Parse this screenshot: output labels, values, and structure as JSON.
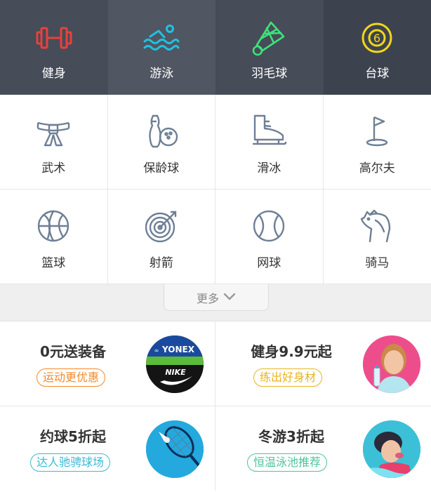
{
  "top_row": [
    {
      "label": "健身",
      "icon": "dumbbell-icon",
      "bg": "#464c58",
      "color": "#e8413c"
    },
    {
      "label": "游泳",
      "icon": "swimmer-icon",
      "bg": "#505662",
      "color": "#1ec3e0"
    },
    {
      "label": "羽毛球",
      "icon": "shuttlecock-icon",
      "bg": "#464c58",
      "color": "#3ee27a"
    },
    {
      "label": "台球",
      "icon": "billiard-ball-icon",
      "bg": "#3d434e",
      "color": "#f2d71a",
      "icon_text": "6"
    }
  ],
  "grid": [
    [
      {
        "label": "武术",
        "icon": "martial-arts-belt-icon"
      },
      {
        "label": "保龄球",
        "icon": "bowling-icon"
      },
      {
        "label": "滑冰",
        "icon": "ice-skate-icon"
      },
      {
        "label": "高尔夫",
        "icon": "golf-flag-icon"
      }
    ],
    [
      {
        "label": "篮球",
        "icon": "basketball-icon"
      },
      {
        "label": "射箭",
        "icon": "archery-target-icon"
      },
      {
        "label": "网球",
        "icon": "tennis-ball-icon"
      },
      {
        "label": "骑马",
        "icon": "horse-icon"
      }
    ]
  ],
  "grid_icon_color": "#6e7f96",
  "more": {
    "label": "更多",
    "icon": "chevron-down-icon"
  },
  "promos": [
    [
      {
        "title": "0元送装备",
        "tag": "运动更优惠",
        "tag_color": "#f08a2c",
        "image": "yonex-nike-logo",
        "logo_text_1": "YONEX",
        "logo_text_2": "NIKE"
      },
      {
        "title": "健身9.9元起",
        "tag": "练出好身材",
        "tag_color": "#e6b521",
        "image": "fitness-woman-photo"
      }
    ],
    [
      {
        "title": "约球5折起",
        "tag": "达人驰骋球场",
        "tag_color": "#3ab9d6",
        "image": "badminton-racket-photo"
      },
      {
        "title": "冬游3折起",
        "tag": "恒温泳池推荐",
        "tag_color": "#4cc49a",
        "image": "swimmer-woman-photo"
      }
    ]
  ]
}
